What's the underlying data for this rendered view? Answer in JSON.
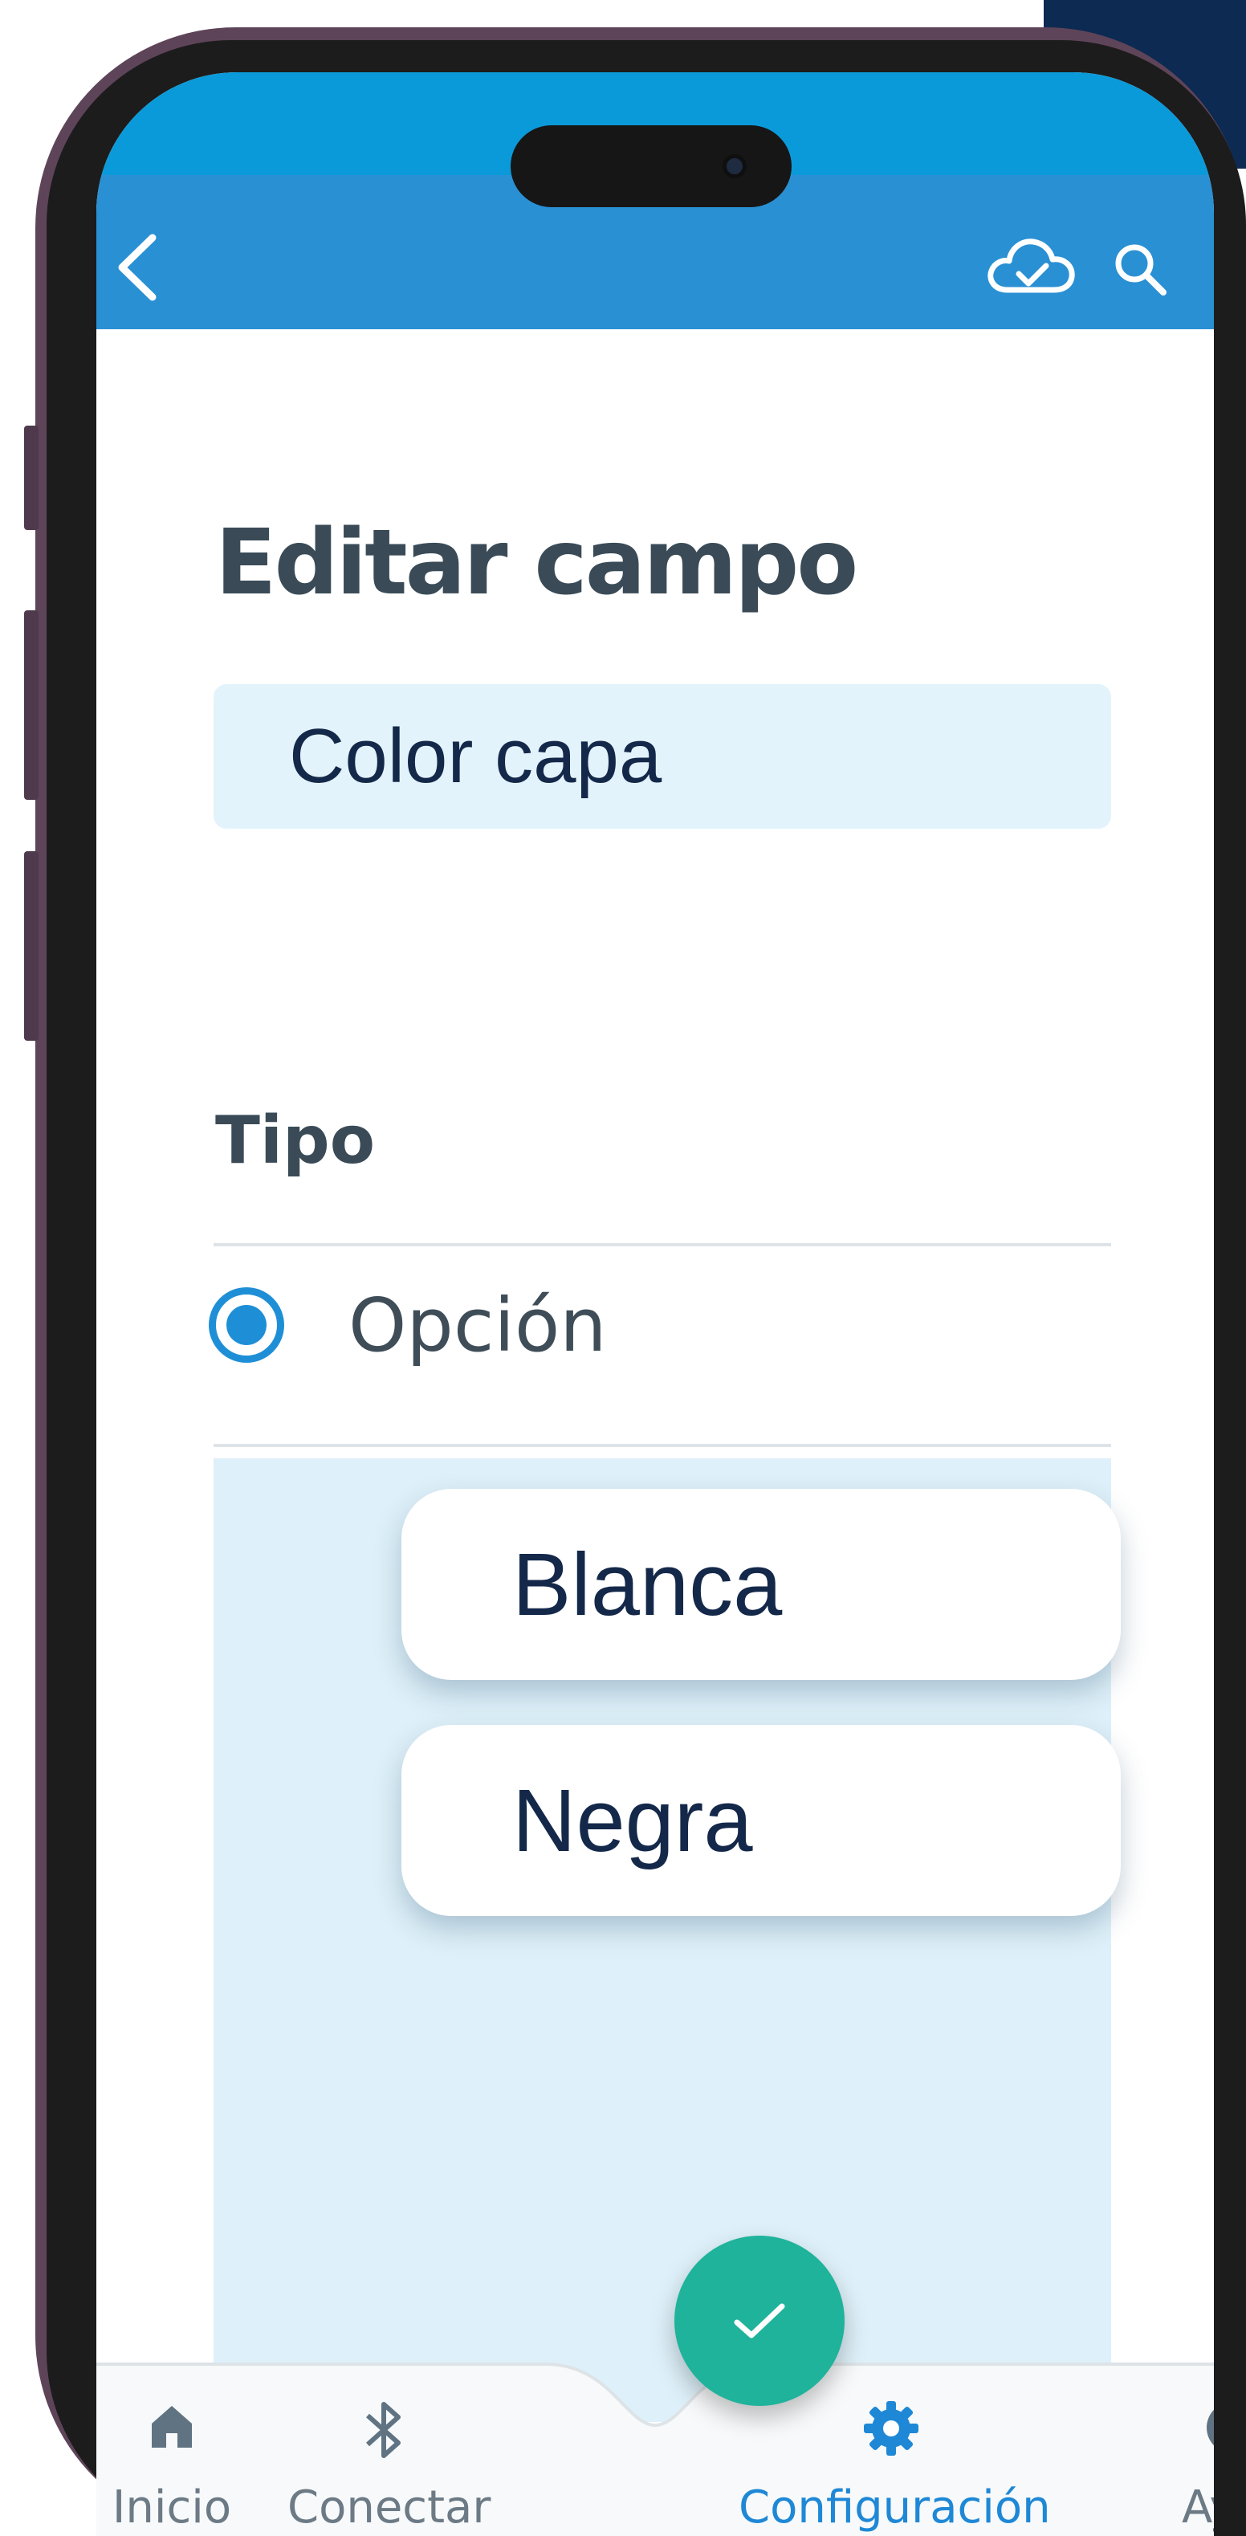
{
  "app_bar": {
    "back": "chevron-left-icon",
    "sync": "cloud-check-icon",
    "search": "search-icon"
  },
  "page": {
    "title": "Editar campo"
  },
  "field_name": {
    "value": "Color capa"
  },
  "type_section": {
    "label": "Tipo",
    "selected_option": "Opción"
  },
  "options": {
    "items": [
      "Blanca",
      "Negra"
    ]
  },
  "fab": {
    "icon": "checkmark-icon"
  },
  "nav": {
    "items": [
      {
        "label": "Inicio",
        "icon": "home-icon"
      },
      {
        "label": "Conectar",
        "icon": "bluetooth-icon"
      },
      {
        "label": "Configuración",
        "icon": "gear-icon",
        "active": true
      },
      {
        "label": "Ayuda",
        "icon": "help-icon"
      }
    ]
  },
  "colors": {
    "app_bar": "#2a90d4",
    "status_bar": "#0b9ad9",
    "accent": "#1e88d6",
    "fab": "#1fb39b",
    "panel": "#def0f9",
    "frame": "#5e4459"
  }
}
